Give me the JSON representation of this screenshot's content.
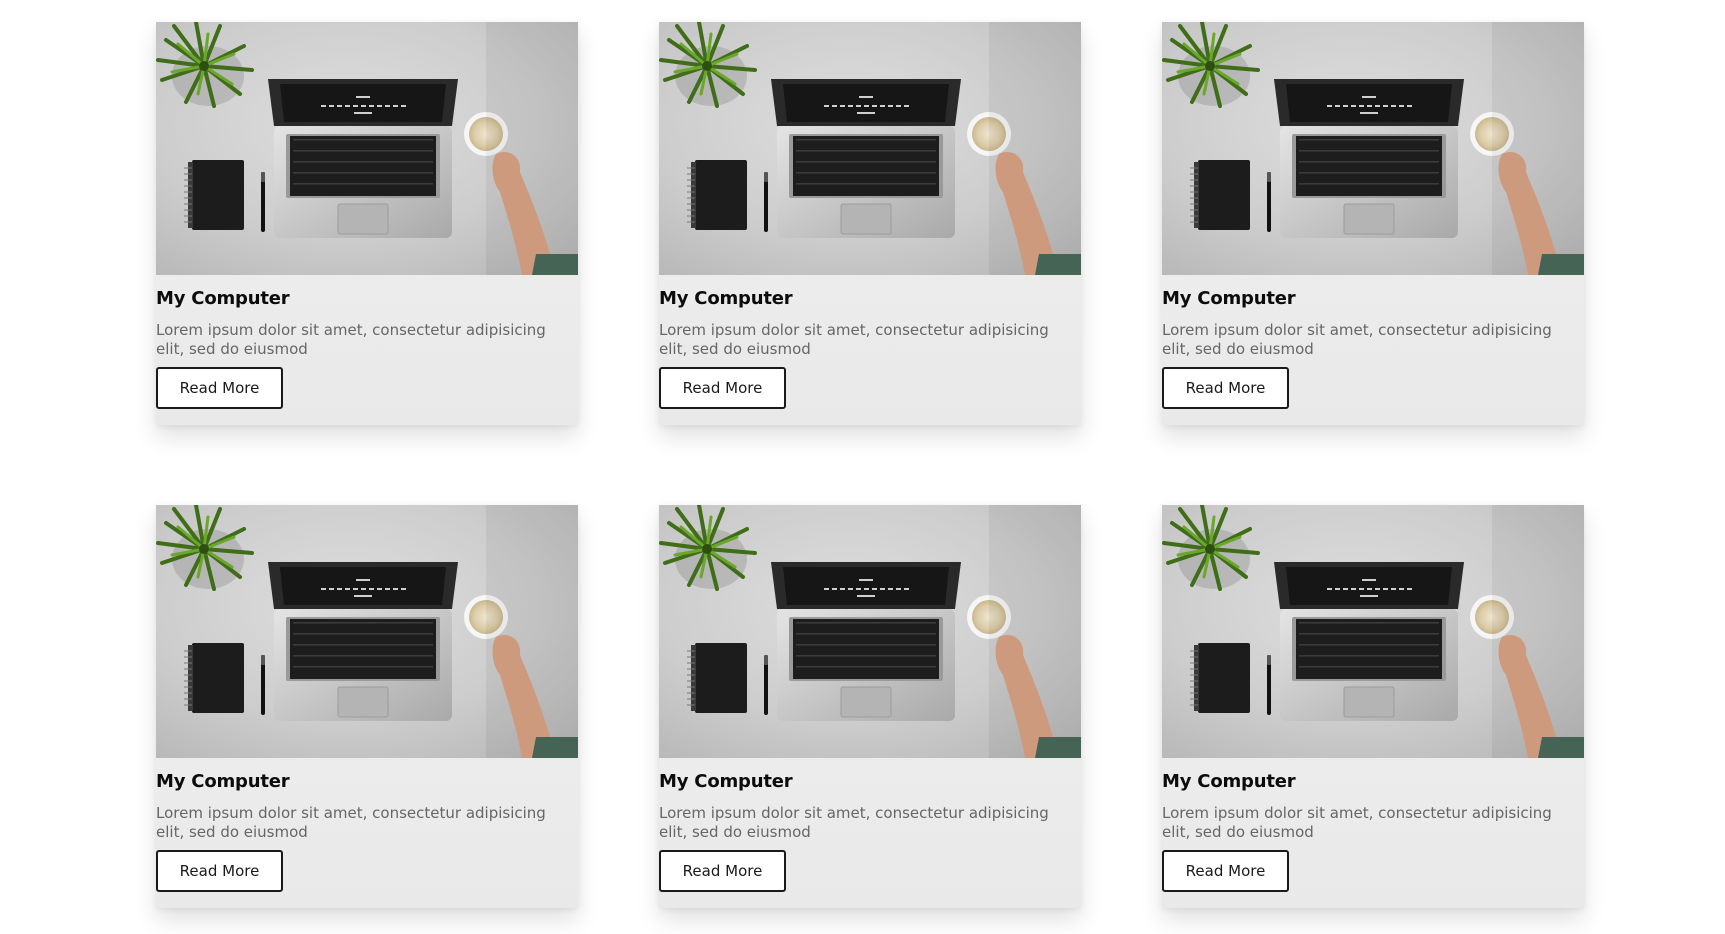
{
  "cards": [
    {
      "title": "My Computer",
      "text": "Lorem ipsum dolor sit amet, consectetur adipisicing elit, sed do eiusmod",
      "button": "Read More",
      "image": "laptop-desk-photo"
    },
    {
      "title": "My Computer",
      "text": "Lorem ipsum dolor sit amet, consectetur adipisicing elit, sed do eiusmod",
      "button": "Read More",
      "image": "laptop-desk-photo"
    },
    {
      "title": "My Computer",
      "text": "Lorem ipsum dolor sit amet, consectetur adipisicing elit, sed do eiusmod",
      "button": "Read More",
      "image": "laptop-desk-photo"
    },
    {
      "title": "My Computer",
      "text": "Lorem ipsum dolor sit amet, consectetur adipisicing elit, sed do eiusmod",
      "button": "Read More",
      "image": "laptop-desk-photo"
    },
    {
      "title": "My Computer",
      "text": "Lorem ipsum dolor sit amet, consectetur adipisicing elit, sed do eiusmod",
      "button": "Read More",
      "image": "laptop-desk-photo"
    },
    {
      "title": "My Computer",
      "text": "Lorem ipsum dolor sit amet, consectetur adipisicing elit, sed do eiusmod",
      "button": "Read More",
      "image": "laptop-desk-photo"
    }
  ],
  "colors": {
    "background": "#ffffff",
    "card_background": "#efefef",
    "title": "#0c0c0c",
    "text": "#666666",
    "button_border": "#1a1a1a"
  }
}
